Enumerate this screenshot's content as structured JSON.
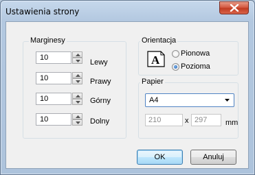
{
  "window": {
    "title": "Ustawienia strony"
  },
  "margins": {
    "legend": "Marginesy",
    "fields": [
      {
        "value": "10",
        "label": "Lewy"
      },
      {
        "value": "10",
        "label": "Prawy"
      },
      {
        "value": "10",
        "label": "Górny"
      },
      {
        "value": "10",
        "label": "Dolny"
      }
    ]
  },
  "orientation": {
    "legend": "Orientacja",
    "icon_letter": "A",
    "options": [
      {
        "label": "Pionowa",
        "selected": false
      },
      {
        "label": "Pozioma",
        "selected": true
      }
    ]
  },
  "paper": {
    "legend": "Papier",
    "selected": "A4",
    "width": "210",
    "separator": "x",
    "height": "297",
    "unit": "mm"
  },
  "buttons": {
    "ok": "OK",
    "cancel": "Anuluj"
  }
}
